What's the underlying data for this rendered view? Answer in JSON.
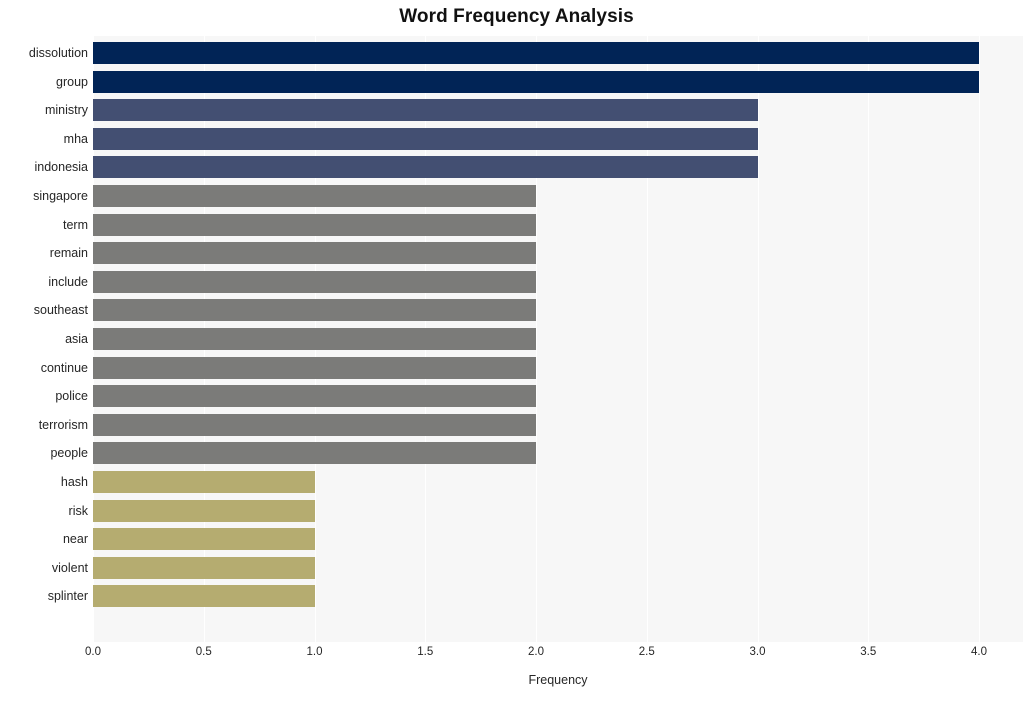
{
  "chart_data": {
    "type": "bar",
    "orientation": "horizontal",
    "title": "Word Frequency Analysis",
    "xlabel": "Frequency",
    "ylabel": "",
    "xlim": [
      0.0,
      4.0
    ],
    "grid": true,
    "legend": null,
    "xticks": [
      "0.0",
      "0.5",
      "1.0",
      "1.5",
      "2.0",
      "2.5",
      "3.0",
      "3.5",
      "4.0"
    ],
    "xtick_values": [
      0.0,
      0.5,
      1.0,
      1.5,
      2.0,
      2.5,
      3.0,
      3.5,
      4.0
    ],
    "categories": [
      "dissolution",
      "group",
      "ministry",
      "mha",
      "indonesia",
      "singapore",
      "term",
      "remain",
      "include",
      "southeast",
      "asia",
      "continue",
      "police",
      "terrorism",
      "people",
      "hash",
      "risk",
      "near",
      "violent",
      "splinter"
    ],
    "values": [
      4,
      4,
      3,
      3,
      3,
      2,
      2,
      2,
      2,
      2,
      2,
      2,
      2,
      2,
      2,
      1,
      1,
      1,
      1,
      1
    ],
    "bar_colors": [
      "#012456",
      "#012456",
      "#434f72",
      "#434f72",
      "#434f72",
      "#7b7b79",
      "#7b7b79",
      "#7b7b79",
      "#7b7b79",
      "#7b7b79",
      "#7b7b79",
      "#7b7b79",
      "#7b7b79",
      "#7b7b79",
      "#7b7b79",
      "#b5ac70",
      "#b5ac70",
      "#b5ac70",
      "#b5ac70",
      "#b5ac70"
    ]
  },
  "style": {
    "plot_background": "#f7f7f7",
    "figure_background": "#ffffff",
    "gridline_color": "#ffffff",
    "text_color": "#262626"
  }
}
